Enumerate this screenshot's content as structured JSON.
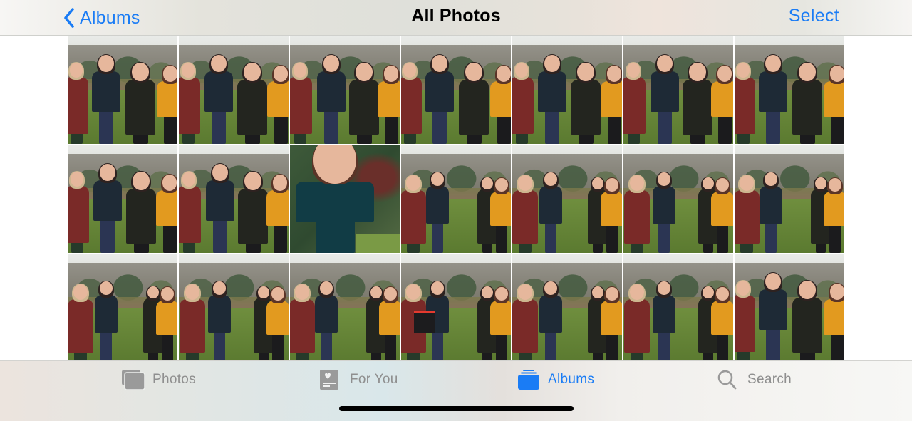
{
  "nav": {
    "back_label": "Albums",
    "title": "All Photos",
    "select_label": "Select"
  },
  "colors": {
    "accent": "#1a7cf5",
    "tab_inactive": "#8f8f8f"
  },
  "grid": {
    "columns": 7,
    "rows": 3,
    "photos": [
      {
        "scene": "group-posed",
        "variant": 0
      },
      {
        "scene": "group-posed",
        "variant": 1
      },
      {
        "scene": "group-posed",
        "variant": 2
      },
      {
        "scene": "group-posed",
        "variant": 3
      },
      {
        "scene": "group-posed",
        "variant": 4
      },
      {
        "scene": "group-posed",
        "variant": 5
      },
      {
        "scene": "group-posed",
        "variant": 6
      },
      {
        "scene": "group-posed",
        "variant": 7
      },
      {
        "scene": "group-posed",
        "variant": 8
      },
      {
        "scene": "closeup-man",
        "variant": 0
      },
      {
        "scene": "group-chat",
        "variant": 0
      },
      {
        "scene": "group-chat",
        "variant": 1
      },
      {
        "scene": "group-chat",
        "variant": 2
      },
      {
        "scene": "group-chat",
        "variant": 3
      },
      {
        "scene": "group-chat",
        "variant": 4
      },
      {
        "scene": "group-chat",
        "variant": 5
      },
      {
        "scene": "group-chat",
        "variant": 6
      },
      {
        "scene": "group-chat-bag",
        "variant": 0
      },
      {
        "scene": "group-chat",
        "variant": 7
      },
      {
        "scene": "group-chat",
        "variant": 8
      },
      {
        "scene": "group-posed",
        "variant": 9
      }
    ]
  },
  "tabbar": {
    "tabs": [
      {
        "label": "Photos",
        "icon": "photos-stack-icon",
        "active": false
      },
      {
        "label": "For You",
        "icon": "for-you-heart-card-icon",
        "active": false
      },
      {
        "label": "Albums",
        "icon": "albums-stack-icon",
        "active": true
      },
      {
        "label": "Search",
        "icon": "search-icon",
        "active": false
      }
    ]
  }
}
